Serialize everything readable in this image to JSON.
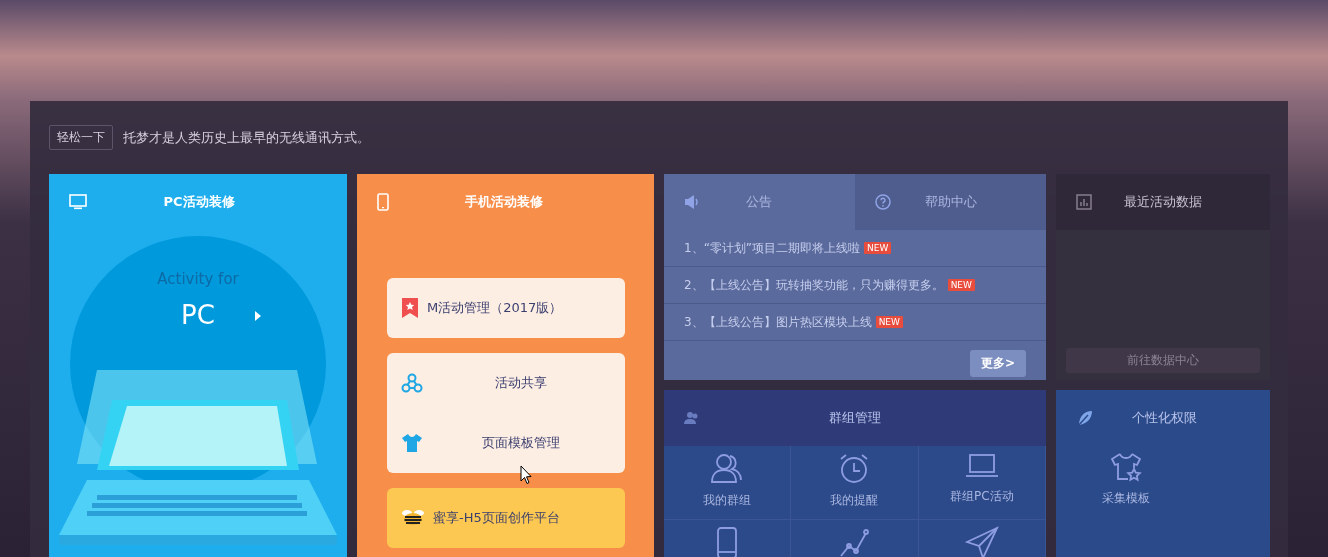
{
  "tip": {
    "label": "轻松一下",
    "text": "托梦才是人类历史上最早的无线通讯方式。"
  },
  "pc_card": {
    "title": "PC活动装修",
    "subtitle": "Activity for",
    "heading": "PC"
  },
  "mobile_card": {
    "title": "手机活动装修",
    "groups": [
      {
        "color": "#fdeee4",
        "items": [
          {
            "kind": "bookmark",
            "label": "M活动管理（2017版）"
          }
        ]
      },
      {
        "color": "#fdeee4",
        "items": [
          {
            "kind": "share",
            "label": "活动共享"
          },
          {
            "kind": "shirt",
            "label": "页面模板管理"
          }
        ]
      },
      {
        "color": "#fdc851",
        "items": [
          {
            "kind": "bee",
            "label": "蜜享-H5页面创作平台"
          }
        ]
      }
    ]
  },
  "notices": {
    "tabs": [
      {
        "kind": "speaker",
        "label": "公告",
        "selected": true
      },
      {
        "kind": "help",
        "label": "帮助中心",
        "selected": false
      }
    ],
    "items": [
      {
        "text": "1、“零计划”项目二期即将上线啦",
        "badge": "NEW"
      },
      {
        "text": "2、【上线公告】玩转抽奖功能，只为赚得更多。",
        "badge": "NEW"
      },
      {
        "text": "3、【上线公告】图片热区模块上线",
        "badge": "NEW"
      }
    ],
    "more": "更多>"
  },
  "data_card": {
    "title": "最近活动数据",
    "button": "前往数据中心"
  },
  "group_card": {
    "title": "群组管理",
    "tiles": [
      {
        "kind": "users",
        "label": "我的群组"
      },
      {
        "kind": "alarm",
        "label": "我的提醒"
      },
      {
        "kind": "laptop",
        "label": "群组PC活动"
      },
      {
        "kind": "phone"
      },
      {
        "kind": "chart"
      },
      {
        "kind": "send"
      }
    ]
  },
  "personal_card": {
    "title": "个性化权限",
    "tiles": [
      {
        "kind": "shirt-star",
        "label": "采集模板"
      }
    ]
  }
}
